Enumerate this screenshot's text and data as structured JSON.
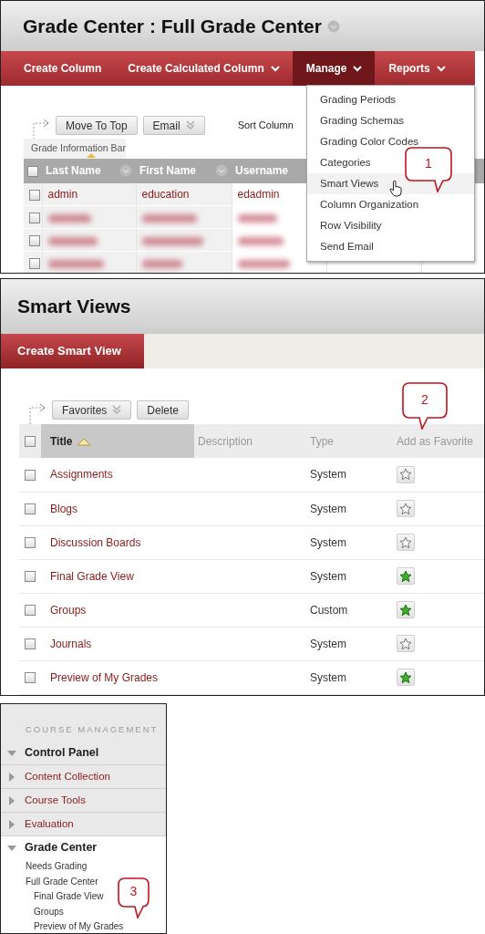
{
  "grade_center": {
    "title": "Grade Center : Full Grade Center",
    "action_bar": [
      {
        "label": "Create Column",
        "has_menu": false,
        "selected": false
      },
      {
        "label": "Create Calculated Column",
        "has_menu": true,
        "selected": false
      },
      {
        "label": "Manage",
        "has_menu": true,
        "selected": true
      },
      {
        "label": "Reports",
        "has_menu": true,
        "selected": false
      }
    ],
    "toolbar": [
      {
        "label": "Move To Top",
        "has_menu": false
      },
      {
        "label": "Email",
        "has_menu": true
      }
    ],
    "sort_label": "Sort Column",
    "info_bar": "Grade Information Bar",
    "table": {
      "columns": [
        {
          "label": "Last Name",
          "sorted": true,
          "has_menu": true
        },
        {
          "label": "First Name",
          "sorted": false,
          "has_menu": true
        },
        {
          "label": "Username",
          "sorted": false,
          "has_menu": false
        }
      ],
      "all_checked": false,
      "rows": [
        {
          "blurred": false,
          "checked": false,
          "cells": [
            "admin",
            "education",
            "edadmin"
          ]
        },
        {
          "blurred": true,
          "checked": false
        },
        {
          "blurred": true,
          "checked": false
        },
        {
          "blurred": true,
          "checked": false
        }
      ]
    },
    "menu": [
      {
        "label": "Grading Periods",
        "selected": false
      },
      {
        "label": "Grading Schemas",
        "selected": false
      },
      {
        "label": "Grading Color Codes",
        "selected": false
      },
      {
        "label": "Categories",
        "selected": false
      },
      {
        "label": "Smart Views",
        "selected": true
      },
      {
        "label": "Column Organization",
        "selected": false
      },
      {
        "label": "Row Visibility",
        "selected": false
      },
      {
        "label": "Send Email",
        "selected": false
      }
    ],
    "callout": "1"
  },
  "smart_views": {
    "title": "Smart Views",
    "action": "Create Smart View",
    "toolbar": [
      {
        "label": "Favorites",
        "has_menu": true
      },
      {
        "label": "Delete",
        "has_menu": false
      }
    ],
    "all_checked": false,
    "columns": [
      {
        "label": "Title",
        "sorted": true
      },
      {
        "label": "Description",
        "sorted": false
      },
      {
        "label": "Type",
        "sorted": false
      },
      {
        "label": "Add as Favorite",
        "sorted": false
      }
    ],
    "rows": [
      {
        "title": "Assignments",
        "type": "System",
        "favorite": false,
        "checked": false
      },
      {
        "title": "Blogs",
        "type": "System",
        "favorite": false,
        "checked": false
      },
      {
        "title": "Discussion Boards",
        "type": "System",
        "favorite": false,
        "checked": false
      },
      {
        "title": "Final Grade View",
        "type": "System",
        "favorite": true,
        "checked": false
      },
      {
        "title": "Groups",
        "type": "Custom",
        "favorite": true,
        "checked": false
      },
      {
        "title": "Journals",
        "type": "System",
        "favorite": false,
        "checked": false
      },
      {
        "title": "Preview of My Grades",
        "type": "System",
        "favorite": true,
        "checked": false
      }
    ],
    "callout": "2"
  },
  "course_menu": {
    "heading": "COURSE MANAGEMENT",
    "tree": {
      "label": "Control Panel",
      "expanded": true,
      "children": [
        {
          "label": "Content Collection",
          "expanded": false
        },
        {
          "label": "Course Tools",
          "expanded": false
        },
        {
          "label": "Evaluation",
          "expanded": false
        },
        {
          "label": "Grade Center",
          "expanded": true,
          "children": [
            {
              "label": "Needs Grading"
            },
            {
              "label": "Full Grade Center",
              "children": [
                {
                  "label": "Final Grade View"
                },
                {
                  "label": "Groups"
                },
                {
                  "label": "Preview of My Grades"
                }
              ]
            }
          ]
        }
      ]
    },
    "callout": "3"
  }
}
